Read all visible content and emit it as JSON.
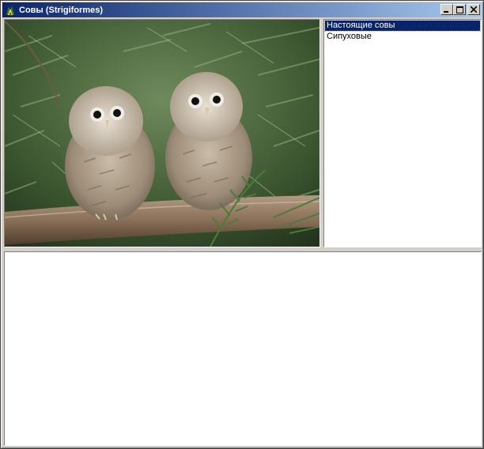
{
  "window": {
    "title": "Совы (Strigiformes)"
  },
  "list": {
    "items": [
      {
        "label": "Настоящие совы",
        "selected": true
      },
      {
        "label": "Сипуховые",
        "selected": false
      }
    ]
  },
  "photo": {
    "subject": "two owl chicks on a branch"
  },
  "description": {
    "text": ""
  },
  "colors": {
    "titlebar_start": "#0a246a",
    "titlebar_end": "#a6caf0",
    "selection": "#0a246a",
    "face": "#d4d0c8"
  }
}
